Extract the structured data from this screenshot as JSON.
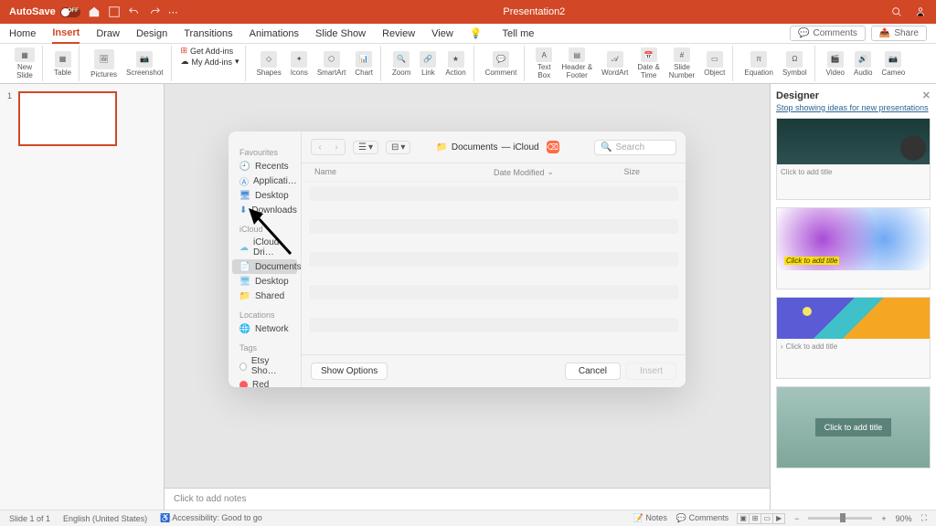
{
  "titlebar": {
    "autosave": "AutoSave",
    "title": "Presentation2"
  },
  "menu": {
    "tabs": [
      "Home",
      "Insert",
      "Draw",
      "Design",
      "Transitions",
      "Animations",
      "Slide Show",
      "Review",
      "View"
    ],
    "active": 1,
    "tellme": "Tell me",
    "comments": "Comments",
    "share": "Share"
  },
  "toolbar": {
    "newslide": "New\nSlide",
    "table": "Table",
    "pictures": "Pictures",
    "screenshot": "Screenshot",
    "getaddins": "Get Add-ins",
    "myaddins": "My Add-ins",
    "shapes": "Shapes",
    "icons": "Icons",
    "smartart": "SmartArt",
    "chart": "Chart",
    "zoom": "Zoom",
    "link": "Link",
    "action": "Action",
    "comment": "Comment",
    "textbox": "Text\nBox",
    "headerfooter": "Header &\nFooter",
    "wordart": "WordArt",
    "datetime": "Date &\nTime",
    "slidenum": "Slide\nNumber",
    "object": "Object",
    "equation": "Equation",
    "symbol": "Symbol",
    "video": "Video",
    "audio": "Audio",
    "cameo": "Cameo"
  },
  "slidenav": {
    "num": "1"
  },
  "notes": {
    "placeholder": "Click to add notes"
  },
  "designer": {
    "title": "Designer",
    "stop": "Stop showing ideas for new presentations",
    "idea1": "Click to add title",
    "idea2": "Click to add title",
    "idea3": "Click to add title",
    "idea4": "Click to add title"
  },
  "finder": {
    "sidebar": {
      "favourites": "Favourites",
      "items_fav": [
        "Recents",
        "Applicati…",
        "Desktop",
        "Downloads"
      ],
      "icloud": "iCloud",
      "items_icloud": [
        "iCloud Dri…",
        "Documents",
        "Desktop",
        "Shared"
      ],
      "locations": "Locations",
      "items_loc": [
        "Network"
      ],
      "tags": "Tags",
      "tag_items": [
        {
          "label": "Etsy Sho…",
          "color": "#fff",
          "border": "#bbb"
        },
        {
          "label": "Red",
          "color": "#ff5b5b"
        }
      ]
    },
    "breadcrumb": {
      "folder": "Documents",
      "suffix": " — iCloud"
    },
    "search_placeholder": "Search",
    "columns": {
      "name": "Name",
      "date": "Date Modified",
      "size": "Size"
    },
    "show_options": "Show Options",
    "cancel": "Cancel",
    "insert": "Insert"
  },
  "statusbar": {
    "slide": "Slide 1 of 1",
    "lang": "English (United States)",
    "access": "Accessibility: Good to go",
    "notes": "Notes",
    "comments": "Comments",
    "zoom": "90%"
  }
}
